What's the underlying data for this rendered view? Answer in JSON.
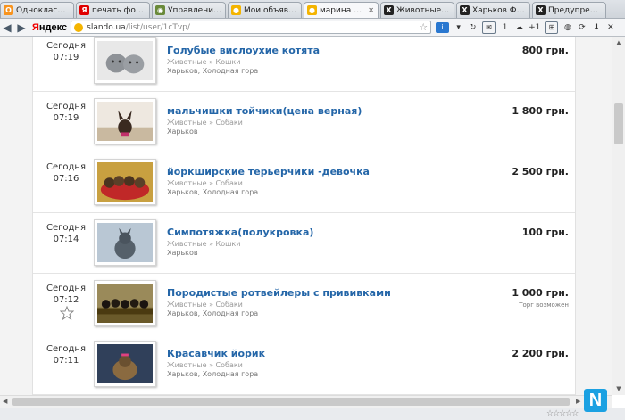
{
  "tabs": [
    {
      "label": "Одноклассники",
      "icon": "odnoklassniki-icon",
      "color": "#f7931e",
      "glyph": "О"
    },
    {
      "label": "печать фотограф...",
      "icon": "yandex-icon",
      "color": "#e00000",
      "glyph": "Я"
    },
    {
      "label": "Управление об...",
      "icon": "site-icon",
      "color": "#6a8a3a",
      "glyph": "◉"
    },
    {
      "label": "Мои объявлени...",
      "icon": "slando-icon",
      "color": "#f4b400",
      "glyph": "●"
    },
    {
      "label": "марина Харь...",
      "icon": "slando-icon",
      "color": "#f4b400",
      "glyph": "●",
      "active": true
    },
    {
      "label": "Животные - Ст...",
      "icon": "forum-icon",
      "color": "#222222",
      "glyph": "Х"
    },
    {
      "label": "Харьков Форум...",
      "icon": "forum-icon",
      "color": "#222222",
      "glyph": "Х"
    },
    {
      "label": "Предупрежден...",
      "icon": "forum-icon",
      "color": "#222222",
      "glyph": "Х"
    }
  ],
  "addressbar": {
    "brand": "Яндекс",
    "url_host": "slando.ua",
    "url_path": "/list/user/1cTvp/",
    "mail_count": "1",
    "plus_count": "+1"
  },
  "listings": [
    {
      "date": "Сегодня",
      "time": "07:19",
      "title": "Голубые вислоухие котята",
      "category": "Животные » Кошки",
      "city": "Харьков, Холодная гора",
      "price": "800 грн.",
      "note": "",
      "image": "kittens"
    },
    {
      "date": "Сегодня",
      "time": "07:19",
      "title": "мальчишки тойчики(цена верная)",
      "category": "Животные » Собаки",
      "city": "Харьков",
      "price": "1 800 грн.",
      "note": "",
      "image": "toy-terrier"
    },
    {
      "date": "Сегодня",
      "time": "07:16",
      "title": "йоркширские терьерчики -девочка",
      "category": "Животные » Собаки",
      "city": "Харьков, Холодная гора",
      "price": "2 500 грн.",
      "note": "",
      "image": "yorkies"
    },
    {
      "date": "Сегодня",
      "time": "07:14",
      "title": "Симпотяжка(полукровка)",
      "category": "Животные » Кошки",
      "city": "Харьков",
      "price": "100 грн.",
      "note": "",
      "image": "cat"
    },
    {
      "date": "Сегодня",
      "time": "07:12",
      "title": "Породистые ротвейлеры с прививками",
      "category": "Животные » Собаки",
      "city": "Харьков, Холодная гора",
      "price": "1 000 грн.",
      "note": "Торг возможен",
      "image": "rottweilers"
    },
    {
      "date": "Сегодня",
      "time": "07:11",
      "title": "Красавчик йорик",
      "category": "Животные » Собаки",
      "city": "Харьков, Холодная гора",
      "price": "2 200 грн.",
      "note": "",
      "image": "yorkie"
    }
  ],
  "colors": {
    "link": "#2466a8",
    "accent_badge": "#1ba1e2"
  }
}
